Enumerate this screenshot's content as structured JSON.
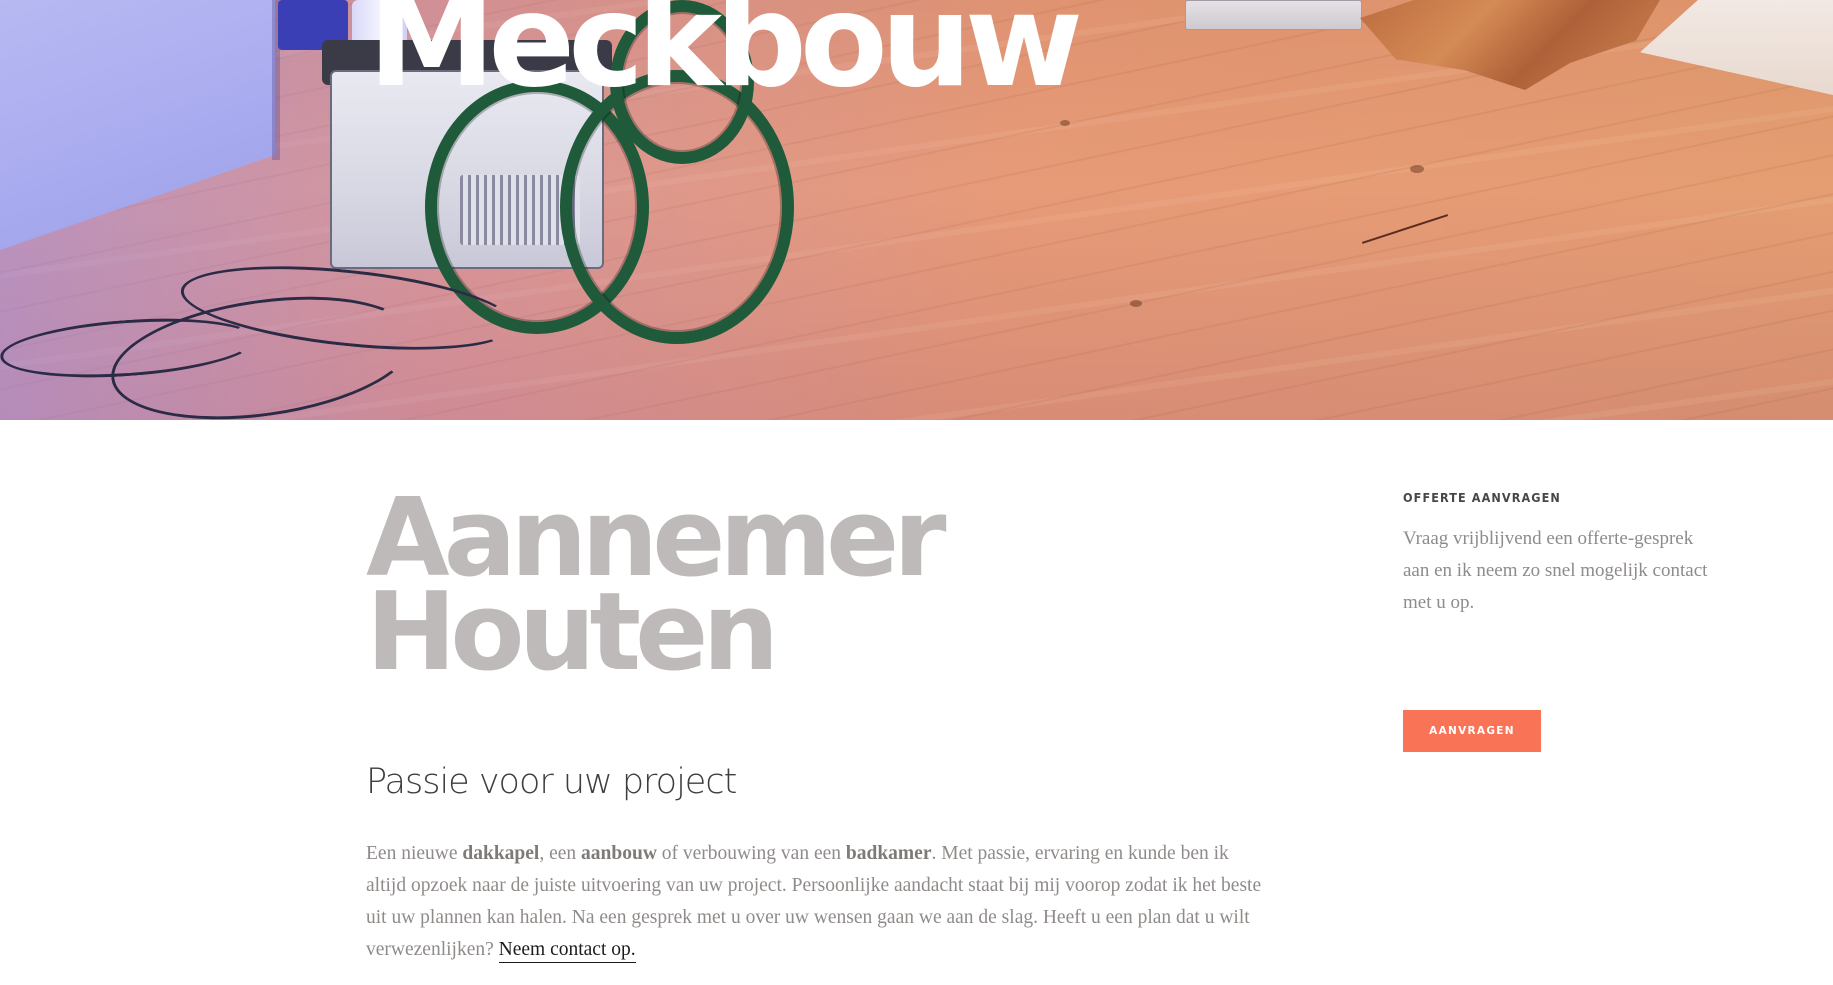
{
  "site": {
    "title": "Meckbouw"
  },
  "main": {
    "heading_line1": "Aannemer",
    "heading_line2": "Houten",
    "subheading": "Passie voor uw project",
    "intro": {
      "t1": "Een nieuwe ",
      "b1": "dakkapel",
      "t2": ", een ",
      "b2": "aanbouw",
      "t3": " of verbouwing van een ",
      "b3": "badkamer",
      "t4": ". Met passie, ervaring en kunde ben ik altijd opzoek naar de juiste uitvoering van uw project. Persoonlijke aandacht staat bij mij voorop zodat ik het beste uit uw plannen kan halen. Na een gesprek met u over uw wensen gaan we aan de slag. Heeft u een plan dat u wilt verwezenlijken? ",
      "link": "Neem contact op."
    }
  },
  "sidebar": {
    "title": "OFFERTE AANVRAGEN",
    "text": "Vraag vrijblijvend een offerte-gesprek aan en ik neem zo snel mogelijk contact met u op.",
    "button_label": "AANVRAGEN",
    "button_color": "#f97357"
  },
  "colors": {
    "heading_gray": "#bdbab9",
    "body_text": "#8f8b89"
  }
}
